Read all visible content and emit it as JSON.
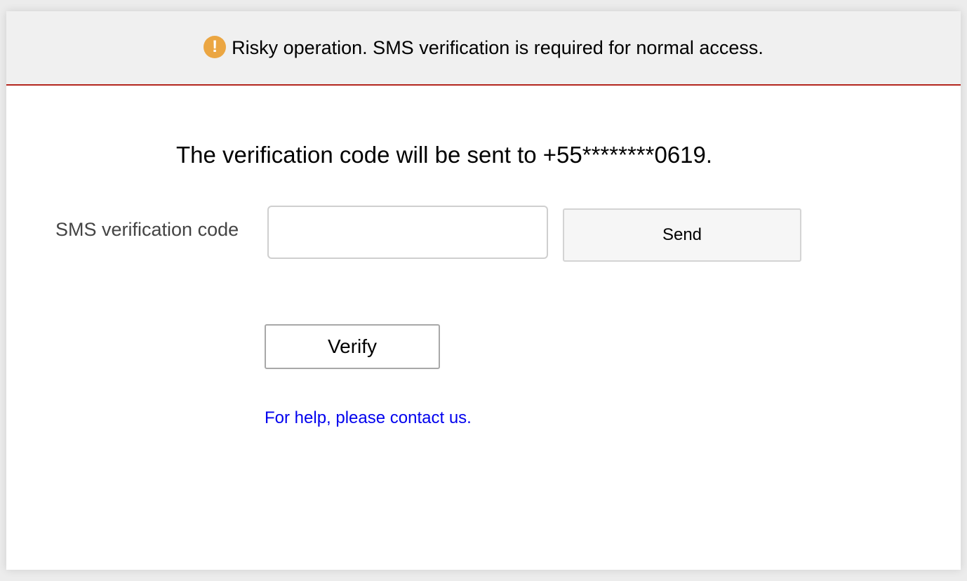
{
  "banner": {
    "icon": "warning-icon",
    "icon_glyph": "!",
    "icon_color": "#eba642",
    "text": "Risky operation. SMS verification is required for normal access.",
    "border_color": "#b3261e"
  },
  "notice": {
    "text": "The verification code will be sent to +55********0619."
  },
  "form": {
    "label": "SMS verification code",
    "code_value": "",
    "code_placeholder": "",
    "send_label": "Send",
    "verify_label": "Verify"
  },
  "help": {
    "link_text": "For help, please contact us.",
    "link_color": "#0000ee"
  }
}
